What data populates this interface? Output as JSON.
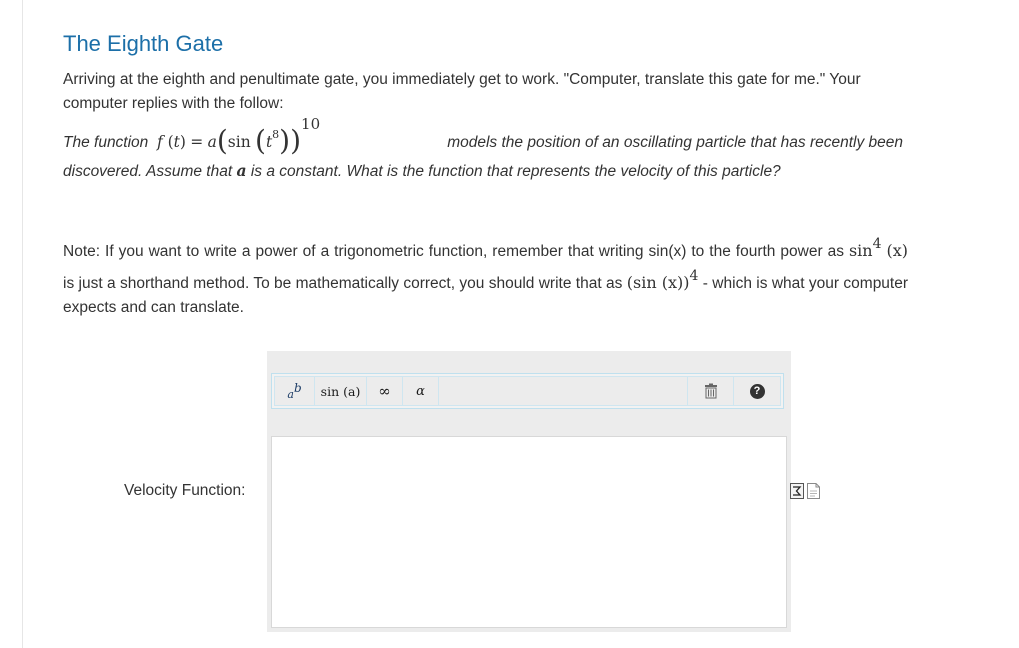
{
  "title": "The Eighth Gate",
  "intro": "Arriving at the eighth and penultimate gate, you immediately get to work. \"Computer, translate this gate for me.\" Your computer replies with the follow:",
  "problem": {
    "lead": "The function",
    "func_name": "f",
    "var": "t",
    "equals": "=",
    "coef": "a",
    "trig": "sin",
    "inner_exp": "8",
    "outer_exp": "10",
    "tail": "models the position of an oscillating particle that has recently been",
    "line2_start": "discovered. Assume that",
    "line2_var": "a",
    "line2_end": "is a constant. What is the function that represents the velocity of this particle?"
  },
  "note": {
    "part1": "Note: If you want to write a power of a trigonometric function, remember that writing sin(x) to the fourth power as",
    "ex1_fn": "sin",
    "ex1_exp": "4",
    "ex1_arg": "(x)",
    "part2": "is just a shorthand method. To be mathematically correct, you should write that as",
    "ex2_fn": "(sin (x))",
    "ex2_exp": "4",
    "part3": "- which is what your computer expects and can translate."
  },
  "toolbar": {
    "power_base": "a",
    "power_exp": "b",
    "sin_label": "sin (a)",
    "infinity": "∞",
    "alpha": "α",
    "help": "?"
  },
  "answer": {
    "label": "Velocity Function:",
    "value": ""
  },
  "icons": [
    "power-icon",
    "trash-icon",
    "help-icon",
    "equation-editor-icon",
    "document-icon"
  ],
  "colors": {
    "title": "#1c6fa8",
    "text": "#333333",
    "toolbar_border": "#bfe0ee"
  }
}
